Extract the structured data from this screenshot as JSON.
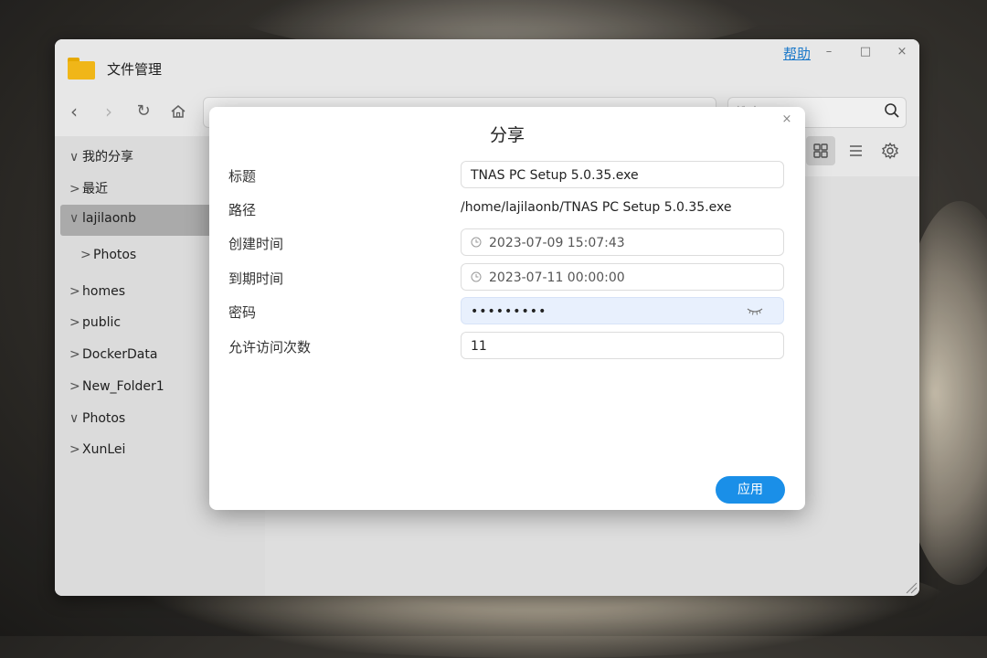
{
  "window": {
    "title": "文件管理",
    "help_label": "帮助",
    "minimize_label": "–",
    "maximize_label": "□",
    "close_label": "×",
    "nav": {
      "back": "‹",
      "forward": "›",
      "refresh": "↻"
    },
    "search": {
      "placeholder": "搜索"
    }
  },
  "sidebar": {
    "items": [
      {
        "label": "我的分享",
        "chevron": "∨"
      },
      {
        "label": "最近",
        "chevron": ">"
      },
      {
        "label": "lajilaonb",
        "chevron": "∨"
      },
      {
        "label": "Photos",
        "chevron": ">"
      },
      {
        "label": "homes",
        "chevron": ">"
      },
      {
        "label": "public",
        "chevron": ">"
      },
      {
        "label": "DockerData",
        "chevron": ">"
      },
      {
        "label": "New_Folder1",
        "chevron": ">"
      },
      {
        "label": "Photos",
        "chevron": "∨"
      },
      {
        "label": "XunLei",
        "chevron": ">"
      }
    ]
  },
  "dialog": {
    "title": "分享",
    "close_label": "×",
    "fields": {
      "title": {
        "label": "标题",
        "value": "TNAS PC Setup 5.0.35.exe"
      },
      "path": {
        "label": "路径",
        "value": "/home/lajilaonb/TNAS PC Setup 5.0.35.exe"
      },
      "created": {
        "label": "创建时间",
        "value": "2023-07-09 15:07:43"
      },
      "expires": {
        "label": "到期时间",
        "value": "2023-07-11 00:00:00"
      },
      "password": {
        "label": "密码",
        "value": "•••••••••"
      },
      "visits": {
        "label": "允许访问次数",
        "value": "11"
      }
    },
    "apply_label": "应用"
  },
  "colors": {
    "accent": "#1a8fe8",
    "link": "#1a7fd6",
    "folder": "#ffc21a",
    "sidebar_selected": "#b5b5b5",
    "password_bg": "#e8f0fd"
  }
}
